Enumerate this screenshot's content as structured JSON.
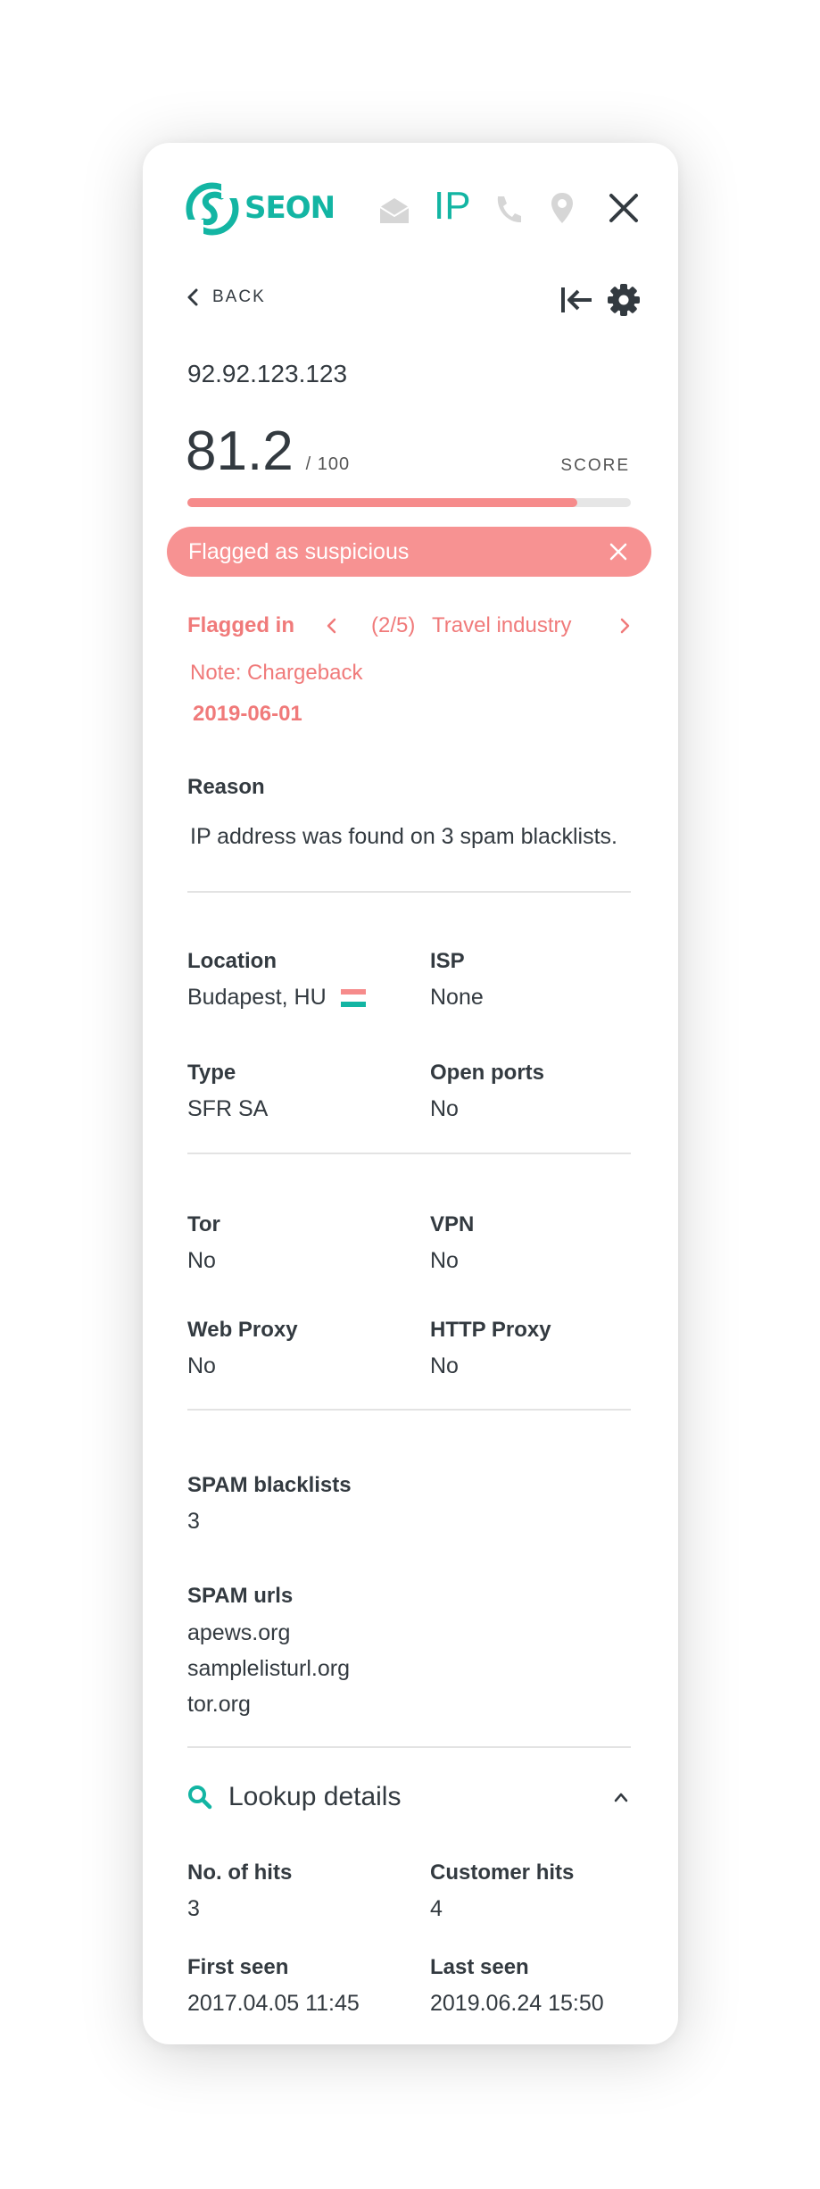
{
  "brand": {
    "name": "SEON",
    "accent": "#13b5a3",
    "danger": "#f79292"
  },
  "header": {
    "tabs": [
      {
        "icon": "envelope-icon"
      },
      {
        "label": "IP"
      },
      {
        "icon": "phone-icon"
      },
      {
        "icon": "location-pin-icon"
      }
    ],
    "close_icon": "close-icon"
  },
  "nav": {
    "back_label": "BACK"
  },
  "ip": {
    "address": "92.92.123.123"
  },
  "score": {
    "value": "81.2",
    "max": "/ 100",
    "label": "SCORE",
    "fraction": 0.88
  },
  "banner": {
    "text": "Flagged as suspicious"
  },
  "flagged": {
    "label": "Flagged in",
    "position": "(2/5)",
    "industry": "Travel industry",
    "note": "Note: Chargeback",
    "date": "2019-06-01"
  },
  "reason": {
    "label": "Reason",
    "text": "IP address was found on 3 spam blacklists."
  },
  "details": {
    "location_label": "Location",
    "location_value": "Budapest, HU",
    "isp_label": "ISP",
    "isp_value": "None",
    "type_label": "Type",
    "type_value": "SFR SA",
    "ports_label": "Open ports",
    "ports_value": "No",
    "tor_label": "Tor",
    "tor_value": "No",
    "vpn_label": "VPN",
    "vpn_value": "No",
    "webproxy_label": "Web Proxy",
    "webproxy_value": "No",
    "httpproxy_label": "HTTP Proxy",
    "httpproxy_value": "No"
  },
  "spam": {
    "blacklists_label": "SPAM blacklists",
    "blacklists_value": "3",
    "urls_label": "SPAM urls",
    "urls": [
      "apews.org",
      "samplelisturl.org",
      "tor.org"
    ]
  },
  "lookup": {
    "title": "Lookup details",
    "hits_label": "No. of hits",
    "hits_value": "3",
    "customer_label": "Customer hits",
    "customer_value": "4",
    "first_label": "First seen",
    "first_value": "2017.04.05 11:45",
    "last_label": "Last seen",
    "last_value": "2019.06.24 15:50"
  }
}
